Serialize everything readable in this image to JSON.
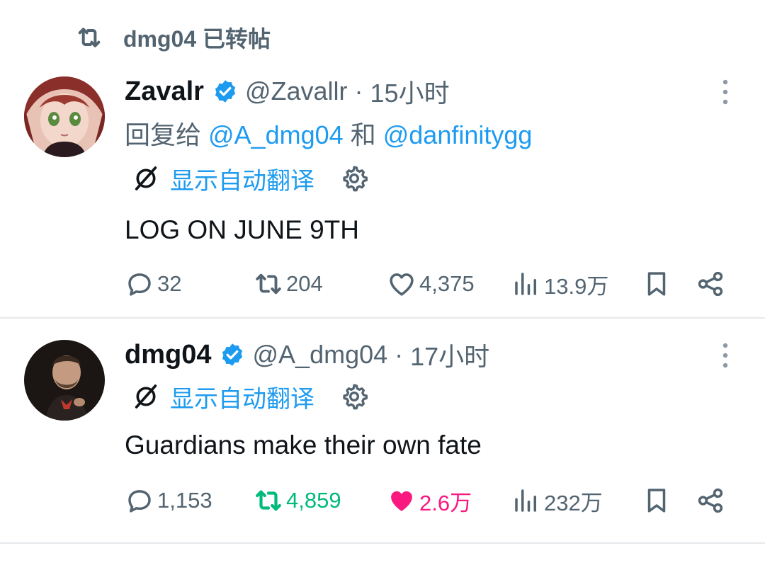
{
  "retweet_banner": {
    "text": "dmg04 已转帖",
    "icon": "retweet-icon"
  },
  "tweets": [
    {
      "name": "Zavalr",
      "handle": "@Zavallr",
      "separator": "·",
      "time": "15小时",
      "reply_prefix": "回复给",
      "reply_mention_1": "@A_dmg04",
      "reply_and": "和",
      "reply_mention_2": "@danfinitygg",
      "translate_label": "显示自动翻译",
      "text": "LOG ON JUNE 9TH",
      "replies": "32",
      "reposts": "204",
      "likes": "4,375",
      "views": "13.9万",
      "reposted_by_user": false,
      "liked_by_user": false
    },
    {
      "name": "dmg04",
      "handle": "@A_dmg04",
      "separator": "·",
      "time": "17小时",
      "translate_label": "显示自动翻译",
      "text": "Guardians make their own fate",
      "replies": "1,153",
      "reposts": "4,859",
      "likes": "2.6万",
      "views": "232万",
      "reposted_by_user": true,
      "liked_by_user": true
    }
  ],
  "colors": {
    "link": "#1d9bf0",
    "muted": "#536471",
    "text": "#0f1419",
    "repost_active": "#00ba7c",
    "like_active": "#f91880",
    "divider": "#e6e9eb"
  }
}
